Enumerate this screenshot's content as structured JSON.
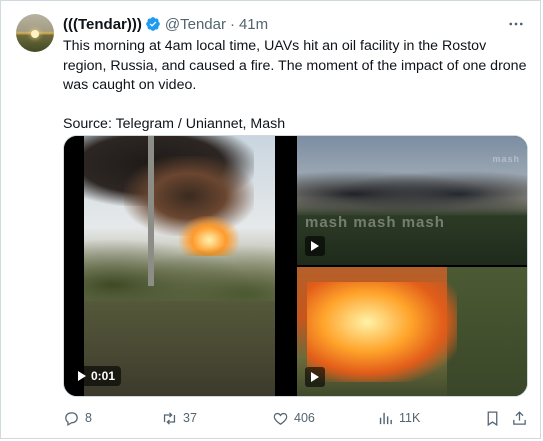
{
  "author": {
    "display_name": "(((Tendar)))",
    "handle": "@Tendar",
    "separator": "·",
    "time": "41m"
  },
  "tweet": {
    "text": "This morning at 4am local time, UAVs hit an oil facility in the Rostov region, Russia, and caused a fire. The moment of the impact of one drone was caught on video.",
    "source": "Source: Telegram / Uniannet, Mash"
  },
  "media": {
    "main_duration": "0:01",
    "watermark_tr": "mash  mash  mash",
    "watermark_logo": "mash"
  },
  "actions": {
    "replies": "8",
    "reposts": "37",
    "likes": "406",
    "views": "11K"
  },
  "icons": {
    "verified": "verified-badge-icon",
    "more": "more-horizontal-icon",
    "reply": "reply-icon",
    "repost": "repost-icon",
    "like": "heart-icon",
    "views": "views-chart-icon",
    "bookmark": "bookmark-icon",
    "share": "share-icon"
  },
  "colors": {
    "accent": "#1d9bf0",
    "text": "#0f1419",
    "muted": "#536471",
    "border": "#cfd9de"
  }
}
